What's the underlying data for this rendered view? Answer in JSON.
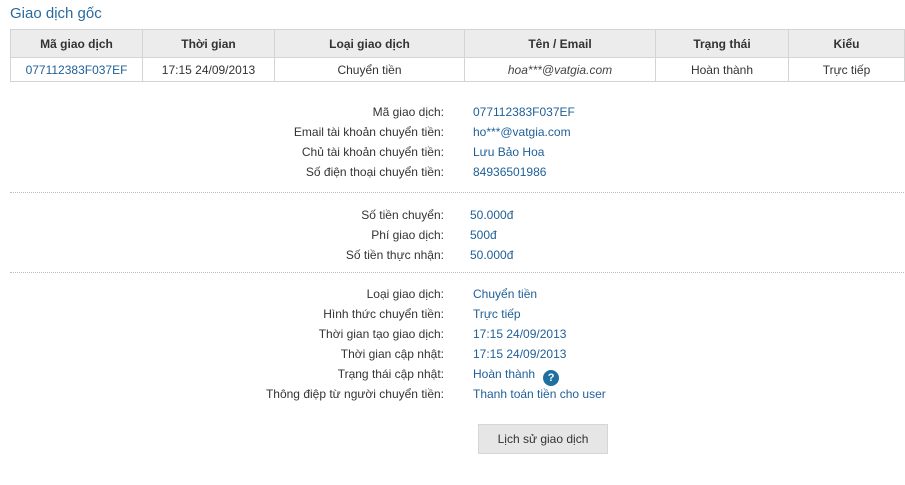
{
  "section_title": "Giao dịch gốc",
  "table": {
    "headers": [
      "Mã giao dịch",
      "Thời gian",
      "Loại giao dịch",
      "Tên / Email",
      "Trạng thái",
      "Kiểu"
    ],
    "row": {
      "code": "077112383F037EF",
      "time": "17:15 24/09/2013",
      "type": "Chuyển tiền",
      "email": "hoa***@vatgia.com",
      "status": "Hoàn thành",
      "kind": "Trực tiếp"
    }
  },
  "sender": {
    "code_label": "Mã giao dịch:",
    "code_value": "077112383F037EF",
    "email_label": "Email tài khoản chuyển tiền:",
    "email_value": "ho***@vatgia.com",
    "owner_label": "Chủ tài khoản chuyển tiền:",
    "owner_value": "Lưu Bảo Hoa",
    "phone_label": "Số điện thoại chuyển tiền:",
    "phone_value": "84936501986"
  },
  "amounts": {
    "sent_label": "Số tiền chuyển:",
    "sent_value": "50.000đ",
    "fee_label": "Phí giao dịch:",
    "fee_value": "500đ",
    "received_label": "Số tiền thực nhận:",
    "received_value": "50.000đ"
  },
  "info": {
    "type_label": "Loại giao dịch:",
    "type_value": "Chuyển tiền",
    "method_label": "Hình thức chuyển tiền:",
    "method_value": "Trực tiếp",
    "created_label": "Thời gian tạo giao dịch:",
    "created_value": "17:15 24/09/2013",
    "updated_label": "Thời gian cập nhật:",
    "updated_value": "17:15 24/09/2013",
    "status_label": "Trạng thái cập nhật:",
    "status_value": "Hoàn thành",
    "help_glyph": "?",
    "message_label": "Thông điệp từ người chuyển tiền:",
    "message_value": "Thanh toán tiền cho user"
  },
  "history_button": "Lịch sử giao dịch",
  "icons": {
    "status_help": "help-icon"
  },
  "colors": {
    "link": "#1f5f97",
    "title": "#2a6a9e",
    "help_icon_bg": "#1f6f9f",
    "header_bg": "#ececec",
    "button_bg": "#e6e6e6"
  }
}
